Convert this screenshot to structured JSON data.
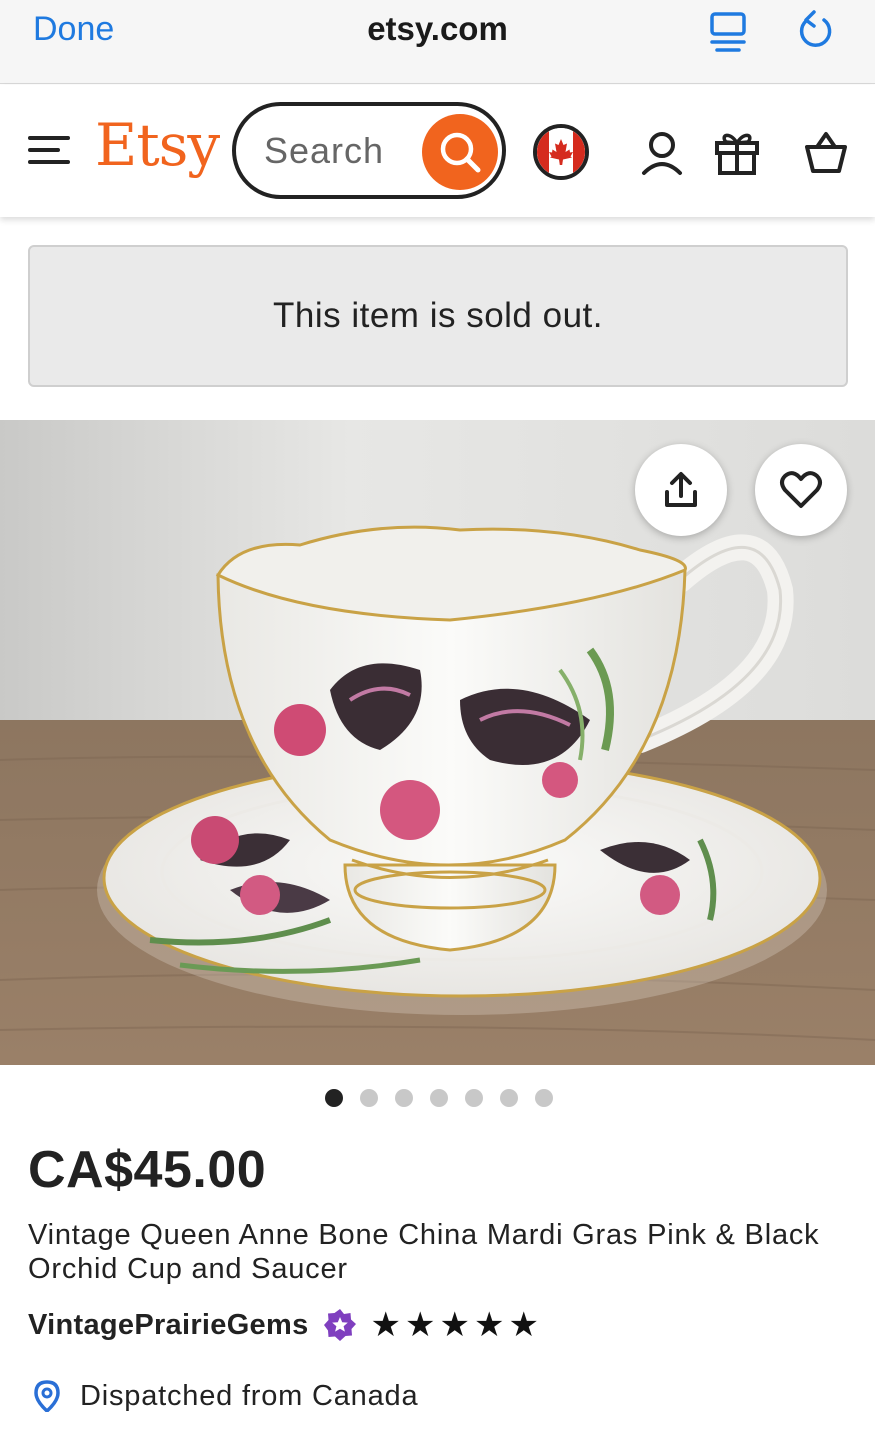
{
  "browser": {
    "done_label": "Done",
    "url": "etsy.com",
    "accent_color": "#1f7ae0"
  },
  "header": {
    "logo_text": "Etsy",
    "search_placeholder": "Search",
    "brand_color": "#f1641e",
    "icons": [
      "menu-icon",
      "search-icon",
      "canada-flag-icon",
      "account-icon",
      "gift-icon",
      "cart-icon"
    ]
  },
  "notice": {
    "sold_out_text": "This item is sold out."
  },
  "gallery": {
    "image_count": 7,
    "active_index": 0,
    "share_icon": "share-icon",
    "favorite_icon": "heart-icon"
  },
  "product": {
    "price": "CA$45.00",
    "title": "Vintage Queen Anne Bone China Mardi Gras Pink & Black Orchid Cup and Saucer",
    "seller_name": "VintagePrairieGems",
    "seller_badge_color": "#7f3fbf",
    "rating_stars": 5,
    "dispatch_text": "Dispatched from Canada",
    "dispatch_icon_color": "#2a6fd6"
  }
}
